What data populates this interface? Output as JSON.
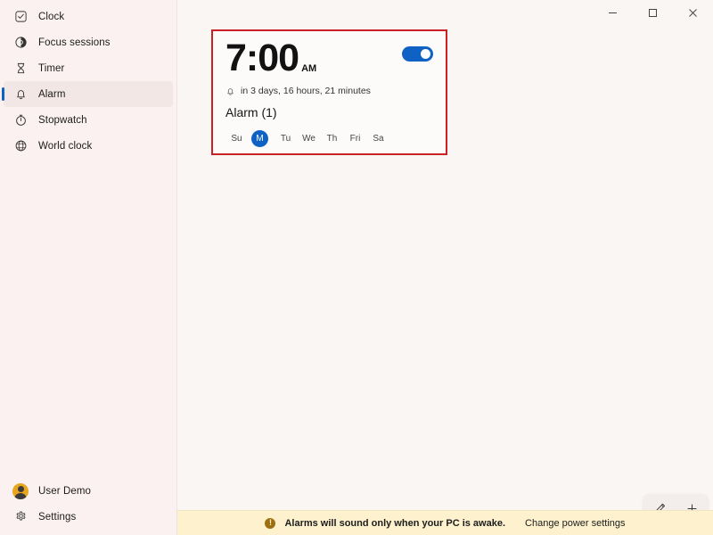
{
  "window": {
    "controls": [
      {
        "name": "minimize",
        "glyph": "minimize-icon"
      },
      {
        "name": "maximize",
        "glyph": "maximize-icon"
      },
      {
        "name": "close",
        "glyph": "close-icon"
      }
    ]
  },
  "sidebar": {
    "items": [
      {
        "label": "Clock",
        "icon": "clock-check-icon",
        "selected": false
      },
      {
        "label": "Focus sessions",
        "icon": "focus-sessions-icon",
        "selected": false
      },
      {
        "label": "Timer",
        "icon": "hourglass-timer-icon",
        "selected": false
      },
      {
        "label": "Alarm",
        "icon": "bell-alarm-icon",
        "selected": true
      },
      {
        "label": "Stopwatch",
        "icon": "stopwatch-icon",
        "selected": false
      },
      {
        "label": "World clock",
        "icon": "world-clock-icon",
        "selected": false
      }
    ],
    "account": {
      "label": "User Demo",
      "icon": "user-avatar"
    },
    "settings": {
      "label": "Settings",
      "icon": "gear-icon"
    }
  },
  "alarm_card": {
    "time": "7:00",
    "meridiem": "AM",
    "toggle_on": true,
    "next_ring": "in 3 days, 16 hours, 21 minutes",
    "next_ring_icon": "bell-icon",
    "name": "Alarm (1)",
    "days": [
      {
        "label": "Su",
        "active": false
      },
      {
        "label": "M",
        "active": true
      },
      {
        "label": "Tu",
        "active": false
      },
      {
        "label": "We",
        "active": false
      },
      {
        "label": "Th",
        "active": false
      },
      {
        "label": "Fri",
        "active": false
      },
      {
        "label": "Sa",
        "active": false
      }
    ]
  },
  "actions": {
    "edit_icon": "pencil-icon",
    "add_icon": "plus-icon"
  },
  "statusbar": {
    "warning_icon": "warning-exclamation-icon",
    "warning_glyph": "!",
    "message": "Alarms will sound only when your PC is awake.",
    "link": "Change power settings"
  },
  "colors": {
    "accent": "#0f62c4",
    "annotation": "#cc2027",
    "sidebar_bg": "#fbf1f0",
    "main_bg": "#faf6f4",
    "status_bg": "#fdf2cd",
    "avatar_bg": "#e8a61f"
  }
}
